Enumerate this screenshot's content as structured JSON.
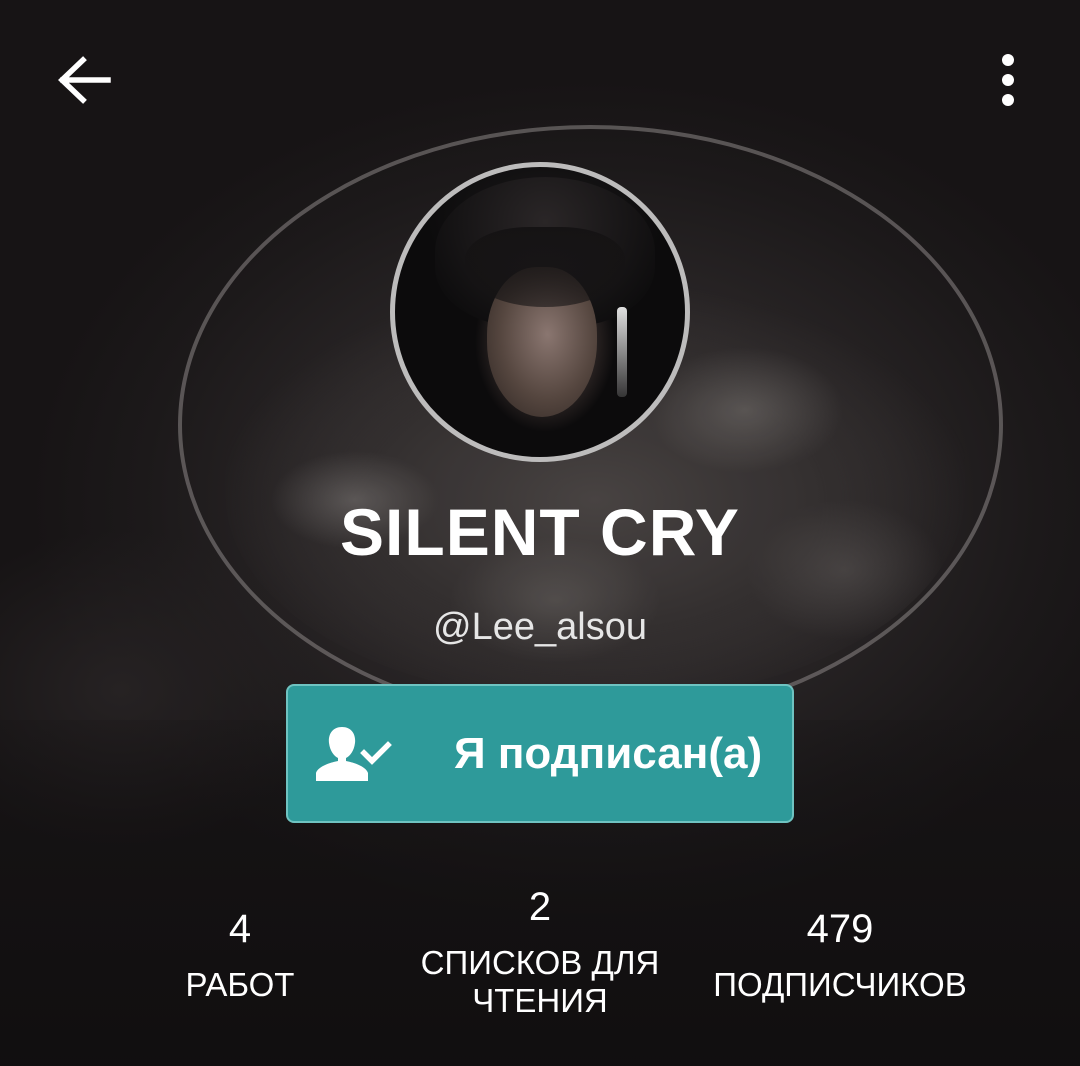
{
  "header": {
    "back_icon": "arrow-left-icon",
    "menu_icon": "more-vertical-icon"
  },
  "profile": {
    "display_name": "SILENT CRY",
    "username": "@Lee_alsou",
    "avatar_icon": "profile-photo"
  },
  "follow_button": {
    "label": "Я подписан(а)",
    "icon": "user-check-icon",
    "color": "#2e9a9a"
  },
  "stats": [
    {
      "value": "4",
      "label": "РАБОТ"
    },
    {
      "value": "2",
      "label_line1": "СПИСКОВ ДЛЯ",
      "label_line2": "ЧТЕНИЯ"
    },
    {
      "value": "479",
      "label": "ПОДПИСЧИКОВ"
    }
  ]
}
